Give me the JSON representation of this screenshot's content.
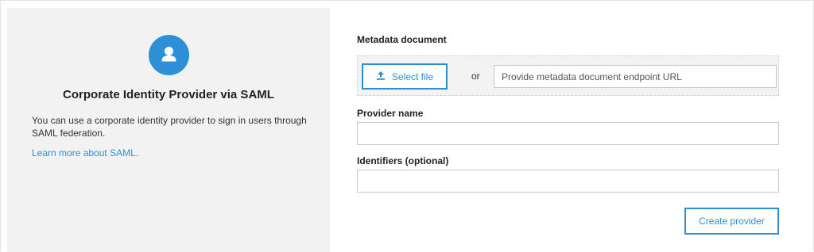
{
  "info_panel": {
    "icon": "user-icon",
    "title": "Corporate Identity Provider via SAML",
    "description": "You can use a corporate identity provider to sign in users through SAML federation.",
    "link_text": "Learn more about SAML."
  },
  "form": {
    "metadata_label": "Metadata document",
    "select_file_label": "Select file",
    "select_file_icon": "upload-icon",
    "or_text": "or",
    "metadata_url_placeholder": "Provide metadata document endpoint URL",
    "metadata_url_value": "",
    "provider_name_label": "Provider name",
    "provider_name_value": "",
    "identifiers_label": "Identifiers (optional)",
    "identifiers_value": "",
    "create_button_label": "Create provider"
  },
  "colors": {
    "accent": "#2d8fd5",
    "panel_background": "#f2f2f2"
  }
}
